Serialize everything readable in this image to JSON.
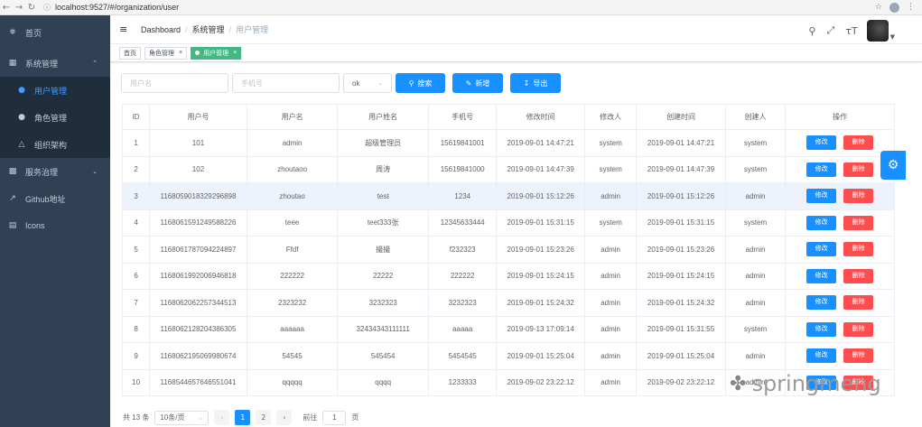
{
  "browser": {
    "url": "localhost:9527/#/organization/user",
    "back_icon": "←",
    "fwd_icon": "→",
    "reload_icon": "C"
  },
  "sidebar": {
    "items": [
      {
        "icon": "dashboard-icon",
        "label": "首页"
      },
      {
        "icon": "grid-icon",
        "label": "系统管理"
      },
      {
        "icon": "user-icon",
        "label": "用户管理"
      },
      {
        "icon": "lock-icon",
        "label": "角色管理"
      },
      {
        "icon": "tree-icon",
        "label": "组织架构"
      },
      {
        "icon": "chart-icon",
        "label": "服务治理"
      },
      {
        "icon": "link-icon",
        "label": "Github地址"
      },
      {
        "icon": "book-icon",
        "label": "Icons"
      }
    ]
  },
  "header": {
    "breadcrumb": [
      "Dashboard",
      "系统管理",
      "用户管理"
    ]
  },
  "tags": {
    "items": [
      "首页",
      "角色管理",
      "用户管理"
    ]
  },
  "filters": {
    "username_placeholder": "用户名",
    "phone_placeholder": "手机号",
    "select_value": "ok",
    "search_label": "搜索",
    "add_label": "新增",
    "export_label": "导出"
  },
  "table": {
    "headers": [
      "ID",
      "用户号",
      "用户名",
      "用户姓名",
      "手机号",
      "修改时间",
      "修改人",
      "创建时间",
      "创建人",
      "操作"
    ],
    "edit_label": "修改",
    "delete_label": "删除",
    "rows": [
      [
        "1",
        "101",
        "admin",
        "超级管理员",
        "15619841001",
        "2019-09-01 14:47:21",
        "system",
        "2019-09-01 14:47:21",
        "system"
      ],
      [
        "2",
        "102",
        "zhoutaoo",
        "周涛",
        "15619841000",
        "2019-09-01 14:47:39",
        "system",
        "2019-09-01 14:47:39",
        "system"
      ],
      [
        "3",
        "1168059018329296898",
        "zhoutao",
        "test",
        "1234",
        "2019-09-01 15:12:26",
        "admin",
        "2019-09-01 15:12:26",
        "admin"
      ],
      [
        "4",
        "1168061591249588226",
        "teee",
        "teet333张",
        "12345633444",
        "2019-09-01 15:31:15",
        "system",
        "2019-09-01 15:31:15",
        "system"
      ],
      [
        "5",
        "1168061787094224897",
        "Ffdf",
        "撮撮",
        "f232323",
        "2019-09-01 15:23:26",
        "admin",
        "2019-09-01 15:23:26",
        "admin"
      ],
      [
        "6",
        "1168061992006946818",
        "222222",
        "22222",
        "222222",
        "2019-09-01 15:24:15",
        "admin",
        "2019-09-01 15:24:15",
        "admin"
      ],
      [
        "7",
        "1168062062257344513",
        "2323232",
        "3232323",
        "3232323",
        "2019-09-01 15:24:32",
        "admin",
        "2019-09-01 15:24:32",
        "admin"
      ],
      [
        "8",
        "1168062128204386305",
        "aaaaaa",
        "32434343111111",
        "aaaaa",
        "2019-09-13 17:09:14",
        "admin",
        "2019-09-01 15:31:55",
        "system"
      ],
      [
        "9",
        "1168062195069980674",
        "54545",
        "545454",
        "5454545",
        "2019-09-01 15:25:04",
        "admin",
        "2019-09-01 15:25:04",
        "admin"
      ],
      [
        "10",
        "1168544657646551041",
        "qqqqq",
        "qqqq",
        "1233333",
        "2019-09-02 23:22:12",
        "admin",
        "2019-09-02 23:22:12",
        "admin"
      ]
    ]
  },
  "pagination": {
    "total": "共 13 条",
    "page_size": "10条/页",
    "pages": [
      "1",
      "2"
    ],
    "goto_label": "前往",
    "goto_value": "1",
    "page_suffix": "页"
  },
  "watermark": "springmeng"
}
